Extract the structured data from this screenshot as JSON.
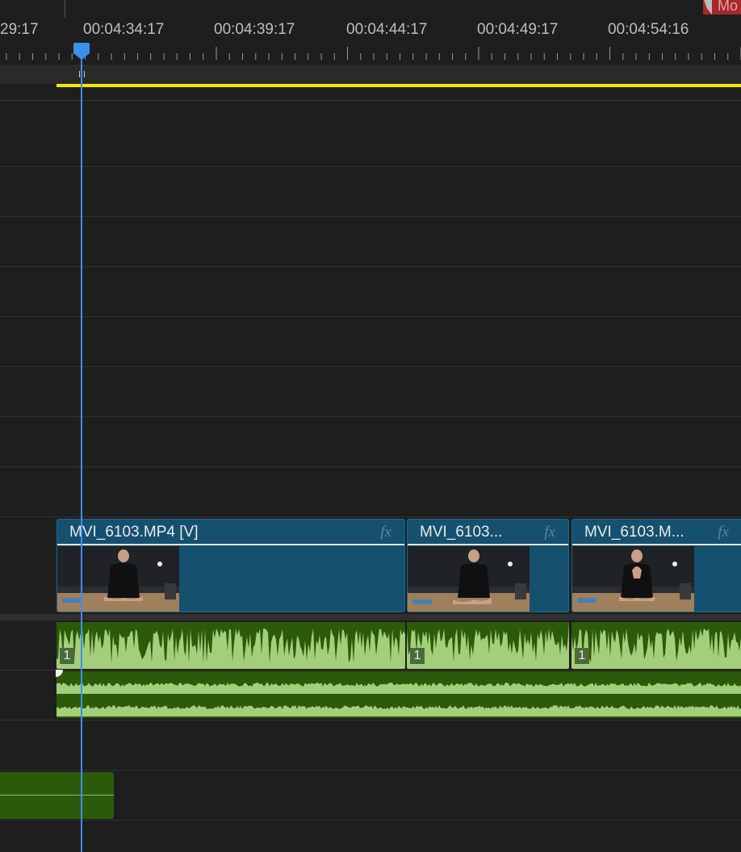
{
  "ruler": {
    "timecodes": [
      "29:17",
      "00:04:34:17",
      "00:04:39:17",
      "00:04:44:17",
      "00:04:49:17",
      "00:04:54:16"
    ]
  },
  "marker": {
    "label": "Mo"
  },
  "video_clips": [
    {
      "name": "MVI_6103.MP4 [V]",
      "fx": "fx"
    },
    {
      "name": "MVI_6103...",
      "fx": "fx"
    },
    {
      "name": "MVI_6103.M...",
      "fx": "fx"
    }
  ],
  "audio_clips": [
    {
      "channel": "1"
    },
    {
      "channel": "1"
    },
    {
      "channel": "1"
    }
  ],
  "colors": {
    "playhead": "#3d8fea",
    "work_area": "#f2ea00",
    "video_clip": "#15506f",
    "audio_clip_light": "#a3cf7a",
    "audio_clip_dark": "#2c5a0b"
  }
}
